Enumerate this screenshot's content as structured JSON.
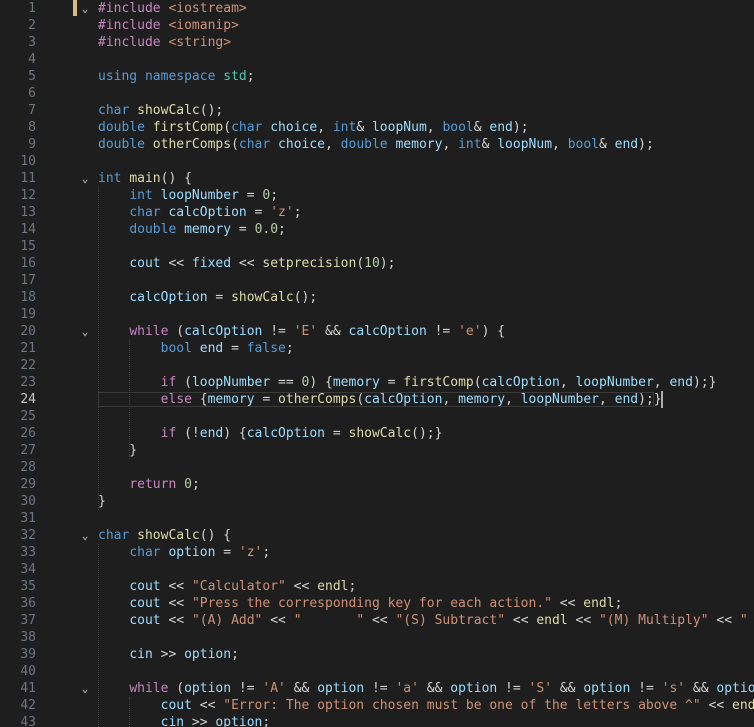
{
  "editor": {
    "current_line": 24,
    "accent_color": "#569cd6",
    "lines": [
      {
        "n": "1",
        "fold": "v",
        "tokens": [
          {
            "t": "#include ",
            "c": "pp"
          },
          {
            "t": "<iostream>",
            "c": "inc"
          }
        ]
      },
      {
        "n": "2",
        "tokens": [
          {
            "t": "#include ",
            "c": "pp"
          },
          {
            "t": "<iomanip>",
            "c": "inc"
          }
        ]
      },
      {
        "n": "3",
        "tokens": [
          {
            "t": "#include ",
            "c": "pp"
          },
          {
            "t": "<string>",
            "c": "inc"
          }
        ]
      },
      {
        "n": "4",
        "tokens": []
      },
      {
        "n": "5",
        "tokens": [
          {
            "t": "using",
            "c": "kw"
          },
          {
            "t": " ",
            "c": "op"
          },
          {
            "t": "namespace",
            "c": "kw"
          },
          {
            "t": " ",
            "c": "op"
          },
          {
            "t": "std",
            "c": "type"
          },
          {
            "t": ";",
            "c": "op"
          }
        ]
      },
      {
        "n": "6",
        "tokens": []
      },
      {
        "n": "7",
        "tokens": [
          {
            "t": "char",
            "c": "kw"
          },
          {
            "t": " ",
            "c": "op"
          },
          {
            "t": "showCalc",
            "c": "fn"
          },
          {
            "t": "();",
            "c": "op"
          }
        ]
      },
      {
        "n": "8",
        "tokens": [
          {
            "t": "double",
            "c": "kw"
          },
          {
            "t": " ",
            "c": "op"
          },
          {
            "t": "firstComp",
            "c": "fn"
          },
          {
            "t": "(",
            "c": "op"
          },
          {
            "t": "char",
            "c": "kw"
          },
          {
            "t": " ",
            "c": "op"
          },
          {
            "t": "choice",
            "c": "var"
          },
          {
            "t": ", ",
            "c": "op"
          },
          {
            "t": "int",
            "c": "kw"
          },
          {
            "t": "& ",
            "c": "op"
          },
          {
            "t": "loopNum",
            "c": "var"
          },
          {
            "t": ", ",
            "c": "op"
          },
          {
            "t": "bool",
            "c": "kw"
          },
          {
            "t": "& ",
            "c": "op"
          },
          {
            "t": "end",
            "c": "var"
          },
          {
            "t": ");",
            "c": "op"
          }
        ]
      },
      {
        "n": "9",
        "tokens": [
          {
            "t": "double",
            "c": "kw"
          },
          {
            "t": " ",
            "c": "op"
          },
          {
            "t": "otherComps",
            "c": "fn"
          },
          {
            "t": "(",
            "c": "op"
          },
          {
            "t": "char",
            "c": "kw"
          },
          {
            "t": " ",
            "c": "op"
          },
          {
            "t": "choice",
            "c": "var"
          },
          {
            "t": ", ",
            "c": "op"
          },
          {
            "t": "double",
            "c": "kw"
          },
          {
            "t": " ",
            "c": "op"
          },
          {
            "t": "memory",
            "c": "var"
          },
          {
            "t": ", ",
            "c": "op"
          },
          {
            "t": "int",
            "c": "kw"
          },
          {
            "t": "& ",
            "c": "op"
          },
          {
            "t": "loopNum",
            "c": "var"
          },
          {
            "t": ", ",
            "c": "op"
          },
          {
            "t": "bool",
            "c": "kw"
          },
          {
            "t": "& ",
            "c": "op"
          },
          {
            "t": "end",
            "c": "var"
          },
          {
            "t": ");",
            "c": "op"
          }
        ]
      },
      {
        "n": "10",
        "tokens": []
      },
      {
        "n": "11",
        "fold": "v",
        "tokens": [
          {
            "t": "int",
            "c": "kw"
          },
          {
            "t": " ",
            "c": "op"
          },
          {
            "t": "main",
            "c": "fn"
          },
          {
            "t": "() {",
            "c": "op"
          }
        ]
      },
      {
        "n": "12",
        "tokens": [
          {
            "t": "    ",
            "c": "op"
          },
          {
            "t": "int",
            "c": "kw"
          },
          {
            "t": " ",
            "c": "op"
          },
          {
            "t": "loopNumber",
            "c": "var"
          },
          {
            "t": " = ",
            "c": "op"
          },
          {
            "t": "0",
            "c": "num"
          },
          {
            "t": ";",
            "c": "op"
          }
        ]
      },
      {
        "n": "13",
        "tokens": [
          {
            "t": "    ",
            "c": "op"
          },
          {
            "t": "char",
            "c": "kw"
          },
          {
            "t": " ",
            "c": "op"
          },
          {
            "t": "calcOption",
            "c": "var"
          },
          {
            "t": " = ",
            "c": "op"
          },
          {
            "t": "'z'",
            "c": "str"
          },
          {
            "t": ";",
            "c": "op"
          }
        ]
      },
      {
        "n": "14",
        "tokens": [
          {
            "t": "    ",
            "c": "op"
          },
          {
            "t": "double",
            "c": "kw"
          },
          {
            "t": " ",
            "c": "op"
          },
          {
            "t": "memory",
            "c": "var"
          },
          {
            "t": " = ",
            "c": "op"
          },
          {
            "t": "0.0",
            "c": "num"
          },
          {
            "t": ";",
            "c": "op"
          }
        ]
      },
      {
        "n": "15",
        "tokens": []
      },
      {
        "n": "16",
        "tokens": [
          {
            "t": "    ",
            "c": "op"
          },
          {
            "t": "cout",
            "c": "var"
          },
          {
            "t": " << ",
            "c": "op"
          },
          {
            "t": "fixed",
            "c": "var"
          },
          {
            "t": " << ",
            "c": "op"
          },
          {
            "t": "setprecision",
            "c": "fn"
          },
          {
            "t": "(",
            "c": "op"
          },
          {
            "t": "10",
            "c": "num"
          },
          {
            "t": ");",
            "c": "op"
          }
        ]
      },
      {
        "n": "17",
        "tokens": []
      },
      {
        "n": "18",
        "tokens": [
          {
            "t": "    ",
            "c": "op"
          },
          {
            "t": "calcOption",
            "c": "var"
          },
          {
            "t": " = ",
            "c": "op"
          },
          {
            "t": "showCalc",
            "c": "fn"
          },
          {
            "t": "();",
            "c": "op"
          }
        ]
      },
      {
        "n": "19",
        "tokens": []
      },
      {
        "n": "20",
        "fold": "v",
        "tokens": [
          {
            "t": "    ",
            "c": "op"
          },
          {
            "t": "while",
            "c": "ctl"
          },
          {
            "t": " (",
            "c": "op"
          },
          {
            "t": "calcOption",
            "c": "var"
          },
          {
            "t": " != ",
            "c": "op"
          },
          {
            "t": "'E'",
            "c": "str"
          },
          {
            "t": " && ",
            "c": "op"
          },
          {
            "t": "calcOption",
            "c": "var"
          },
          {
            "t": " != ",
            "c": "op"
          },
          {
            "t": "'e'",
            "c": "str"
          },
          {
            "t": ") {",
            "c": "op"
          }
        ]
      },
      {
        "n": "21",
        "tokens": [
          {
            "t": "        ",
            "c": "op"
          },
          {
            "t": "bool",
            "c": "kw"
          },
          {
            "t": " ",
            "c": "op"
          },
          {
            "t": "end",
            "c": "var"
          },
          {
            "t": " = ",
            "c": "op"
          },
          {
            "t": "false",
            "c": "kw"
          },
          {
            "t": ";",
            "c": "op"
          }
        ]
      },
      {
        "n": "22",
        "tokens": []
      },
      {
        "n": "23",
        "tokens": [
          {
            "t": "        ",
            "c": "op"
          },
          {
            "t": "if",
            "c": "ctl"
          },
          {
            "t": " (",
            "c": "op"
          },
          {
            "t": "loopNumber",
            "c": "var"
          },
          {
            "t": " == ",
            "c": "op"
          },
          {
            "t": "0",
            "c": "num"
          },
          {
            "t": ") {",
            "c": "op"
          },
          {
            "t": "memory",
            "c": "var"
          },
          {
            "t": " = ",
            "c": "op"
          },
          {
            "t": "firstComp",
            "c": "fn"
          },
          {
            "t": "(",
            "c": "op"
          },
          {
            "t": "calcOption",
            "c": "var"
          },
          {
            "t": ", ",
            "c": "op"
          },
          {
            "t": "loopNumber",
            "c": "var"
          },
          {
            "t": ", ",
            "c": "op"
          },
          {
            "t": "end",
            "c": "var"
          },
          {
            "t": ");}",
            "c": "op"
          }
        ]
      },
      {
        "n": "24",
        "cur": true,
        "tokens": [
          {
            "t": "        ",
            "c": "op"
          },
          {
            "t": "else",
            "c": "ctl"
          },
          {
            "t": " {",
            "c": "op"
          },
          {
            "t": "memory",
            "c": "var"
          },
          {
            "t": " = ",
            "c": "op"
          },
          {
            "t": "otherComps",
            "c": "fn"
          },
          {
            "t": "(",
            "c": "op"
          },
          {
            "t": "calcOption",
            "c": "var"
          },
          {
            "t": ", ",
            "c": "op"
          },
          {
            "t": "memory",
            "c": "var"
          },
          {
            "t": ", ",
            "c": "op"
          },
          {
            "t": "loopNumber",
            "c": "var"
          },
          {
            "t": ", ",
            "c": "op"
          },
          {
            "t": "end",
            "c": "var"
          },
          {
            "t": ");}",
            "c": "op"
          }
        ]
      },
      {
        "n": "25",
        "tokens": []
      },
      {
        "n": "26",
        "tokens": [
          {
            "t": "        ",
            "c": "op"
          },
          {
            "t": "if",
            "c": "ctl"
          },
          {
            "t": " (!",
            "c": "op"
          },
          {
            "t": "end",
            "c": "var"
          },
          {
            "t": ") {",
            "c": "op"
          },
          {
            "t": "calcOption",
            "c": "var"
          },
          {
            "t": " = ",
            "c": "op"
          },
          {
            "t": "showCalc",
            "c": "fn"
          },
          {
            "t": "();}",
            "c": "op"
          }
        ]
      },
      {
        "n": "27",
        "tokens": [
          {
            "t": "    }",
            "c": "op"
          }
        ]
      },
      {
        "n": "28",
        "tokens": []
      },
      {
        "n": "29",
        "tokens": [
          {
            "t": "    ",
            "c": "op"
          },
          {
            "t": "return",
            "c": "ctl"
          },
          {
            "t": " ",
            "c": "op"
          },
          {
            "t": "0",
            "c": "num"
          },
          {
            "t": ";",
            "c": "op"
          }
        ]
      },
      {
        "n": "30",
        "tokens": [
          {
            "t": "}",
            "c": "op"
          }
        ]
      },
      {
        "n": "31",
        "tokens": []
      },
      {
        "n": "32",
        "fold": "v",
        "tokens": [
          {
            "t": "char",
            "c": "kw"
          },
          {
            "t": " ",
            "c": "op"
          },
          {
            "t": "showCalc",
            "c": "fn"
          },
          {
            "t": "() {",
            "c": "op"
          }
        ]
      },
      {
        "n": "33",
        "tokens": [
          {
            "t": "    ",
            "c": "op"
          },
          {
            "t": "char",
            "c": "kw"
          },
          {
            "t": " ",
            "c": "op"
          },
          {
            "t": "option",
            "c": "var"
          },
          {
            "t": " = ",
            "c": "op"
          },
          {
            "t": "'z'",
            "c": "str"
          },
          {
            "t": ";",
            "c": "op"
          }
        ]
      },
      {
        "n": "34",
        "tokens": []
      },
      {
        "n": "35",
        "tokens": [
          {
            "t": "    ",
            "c": "op"
          },
          {
            "t": "cout",
            "c": "var"
          },
          {
            "t": " << ",
            "c": "op"
          },
          {
            "t": "\"Calculator\"",
            "c": "str"
          },
          {
            "t": " << ",
            "c": "op"
          },
          {
            "t": "endl",
            "c": "fn"
          },
          {
            "t": ";",
            "c": "op"
          }
        ]
      },
      {
        "n": "36",
        "tokens": [
          {
            "t": "    ",
            "c": "op"
          },
          {
            "t": "cout",
            "c": "var"
          },
          {
            "t": " << ",
            "c": "op"
          },
          {
            "t": "\"Press the corresponding key for each action.\"",
            "c": "str"
          },
          {
            "t": " << ",
            "c": "op"
          },
          {
            "t": "endl",
            "c": "fn"
          },
          {
            "t": ";",
            "c": "op"
          }
        ]
      },
      {
        "n": "37",
        "tokens": [
          {
            "t": "    ",
            "c": "op"
          },
          {
            "t": "cout",
            "c": "var"
          },
          {
            "t": " << ",
            "c": "op"
          },
          {
            "t": "\"(A) Add\"",
            "c": "str"
          },
          {
            "t": " << ",
            "c": "op"
          },
          {
            "t": "\"       \"",
            "c": "str"
          },
          {
            "t": " << ",
            "c": "op"
          },
          {
            "t": "\"(S) Subtract\"",
            "c": "str"
          },
          {
            "t": " << ",
            "c": "op"
          },
          {
            "t": "endl",
            "c": "fn"
          },
          {
            "t": " << ",
            "c": "op"
          },
          {
            "t": "\"(M) Multiply\"",
            "c": "str"
          },
          {
            "t": " << ",
            "c": "op"
          },
          {
            "t": "\"  \"",
            "c": "str"
          }
        ]
      },
      {
        "n": "38",
        "tokens": []
      },
      {
        "n": "39",
        "tokens": [
          {
            "t": "    ",
            "c": "op"
          },
          {
            "t": "cin",
            "c": "var"
          },
          {
            "t": " >> ",
            "c": "op"
          },
          {
            "t": "option",
            "c": "var"
          },
          {
            "t": ";",
            "c": "op"
          }
        ]
      },
      {
        "n": "40",
        "tokens": []
      },
      {
        "n": "41",
        "fold": "v",
        "tokens": [
          {
            "t": "    ",
            "c": "op"
          },
          {
            "t": "while",
            "c": "ctl"
          },
          {
            "t": " (",
            "c": "op"
          },
          {
            "t": "option",
            "c": "var"
          },
          {
            "t": " != ",
            "c": "op"
          },
          {
            "t": "'A'",
            "c": "str"
          },
          {
            "t": " && ",
            "c": "op"
          },
          {
            "t": "option",
            "c": "var"
          },
          {
            "t": " != ",
            "c": "op"
          },
          {
            "t": "'a'",
            "c": "str"
          },
          {
            "t": " && ",
            "c": "op"
          },
          {
            "t": "option",
            "c": "var"
          },
          {
            "t": " != ",
            "c": "op"
          },
          {
            "t": "'S'",
            "c": "str"
          },
          {
            "t": " && ",
            "c": "op"
          },
          {
            "t": "option",
            "c": "var"
          },
          {
            "t": " != ",
            "c": "op"
          },
          {
            "t": "'s'",
            "c": "str"
          },
          {
            "t": " && ",
            "c": "op"
          },
          {
            "t": "option",
            "c": "var"
          }
        ]
      },
      {
        "n": "42",
        "tokens": [
          {
            "t": "        ",
            "c": "op"
          },
          {
            "t": "cout",
            "c": "var"
          },
          {
            "t": " << ",
            "c": "op"
          },
          {
            "t": "\"Error: The option chosen must be one of the letters above ^\"",
            "c": "str"
          },
          {
            "t": " << ",
            "c": "op"
          },
          {
            "t": "endl",
            "c": "fn"
          },
          {
            "t": ";",
            "c": "op"
          }
        ]
      },
      {
        "n": "43",
        "tokens": [
          {
            "t": "        ",
            "c": "op"
          },
          {
            "t": "cin",
            "c": "var"
          },
          {
            "t": " >> ",
            "c": "op"
          },
          {
            "t": "option",
            "c": "var"
          },
          {
            "t": ";",
            "c": "op"
          }
        ]
      }
    ]
  }
}
